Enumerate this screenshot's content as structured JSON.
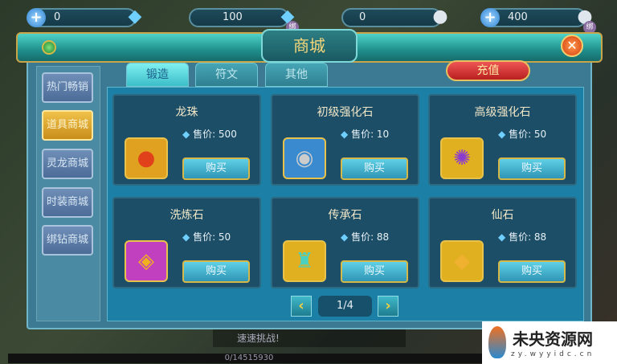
{
  "currencies": [
    {
      "value": "0",
      "icon": "diamond-icon",
      "plus": true,
      "bound": false
    },
    {
      "value": "100",
      "icon": "diamond-icon",
      "plus": false,
      "bound": true,
      "bound_label": "绑"
    },
    {
      "value": "0",
      "icon": "silver-ingot-icon",
      "plus": false,
      "bound": false
    },
    {
      "value": "400",
      "icon": "silver-ingot-icon",
      "plus": true,
      "bound": true,
      "bound_label": "绑"
    }
  ],
  "window": {
    "title": "商城",
    "recharge_label": "充值"
  },
  "sidebar": [
    {
      "label": "热门畅销"
    },
    {
      "label": "道具商城",
      "active": true
    },
    {
      "label": "灵龙商城"
    },
    {
      "label": "时装商城"
    },
    {
      "label": "绑钻商城"
    }
  ],
  "tabs": [
    {
      "label": "锻造",
      "active": true
    },
    {
      "label": "符文"
    },
    {
      "label": "其他"
    }
  ],
  "items": [
    {
      "name": "龙珠",
      "price_label": "售价: 500",
      "buy": "购买"
    },
    {
      "name": "初级强化石",
      "price_label": "售价: 10",
      "buy": "购买"
    },
    {
      "name": "高级强化石",
      "price_label": "售价: 50",
      "buy": "购买"
    },
    {
      "name": "洗炼石",
      "price_label": "售价: 50",
      "buy": "购买"
    },
    {
      "name": "传承石",
      "price_label": "售价: 88",
      "buy": "购买"
    },
    {
      "name": "仙石",
      "price_label": "售价: 88",
      "buy": "购买"
    }
  ],
  "pagination": {
    "label": "1/4"
  },
  "background": {
    "challenge": "速速挑战!",
    "exp": "0/14515930"
  },
  "watermark": {
    "name": "未央资源网",
    "url": "zy.wyyidc.cn"
  }
}
